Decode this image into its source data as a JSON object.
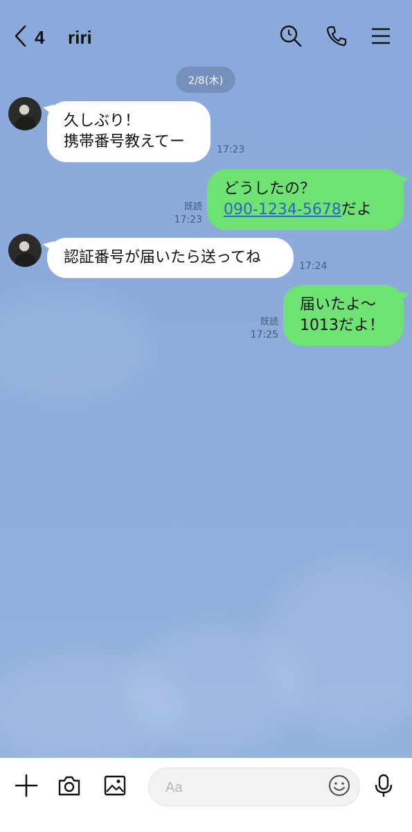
{
  "header": {
    "back_icon": "chevron-left-icon",
    "unread_count": "4",
    "title": "riri",
    "icons": [
      "search-icon",
      "phone-icon",
      "menu-icon"
    ]
  },
  "date_separator": "2/8(木)",
  "messages": [
    {
      "direction": "in",
      "lines": [
        "久しぶり！",
        "携帯番号教えてー"
      ],
      "time": "17:23"
    },
    {
      "direction": "out",
      "line1": "どうしたの？",
      "phone": "090-1234-5678",
      "suffix": "だよ",
      "read": "既読",
      "time": "17:23"
    },
    {
      "direction": "in",
      "lines": [
        "認証番号が届いたら送ってね"
      ],
      "time": "17:24"
    },
    {
      "direction": "out",
      "lines": [
        "届いたよ〜",
        "1013だよ！"
      ],
      "read": "既読",
      "time": "17:25"
    }
  ],
  "composer": {
    "placeholder": "Aa",
    "icons": [
      "plus-icon",
      "camera-icon",
      "image-icon",
      "emoji-icon",
      "microphone-icon"
    ]
  },
  "colors": {
    "chat_background": "#8dacdb",
    "incoming_bubble": "#ffffff",
    "outgoing_bubble": "#6ee273",
    "date_pill": "#7690bd",
    "link": "#2a64c4"
  }
}
